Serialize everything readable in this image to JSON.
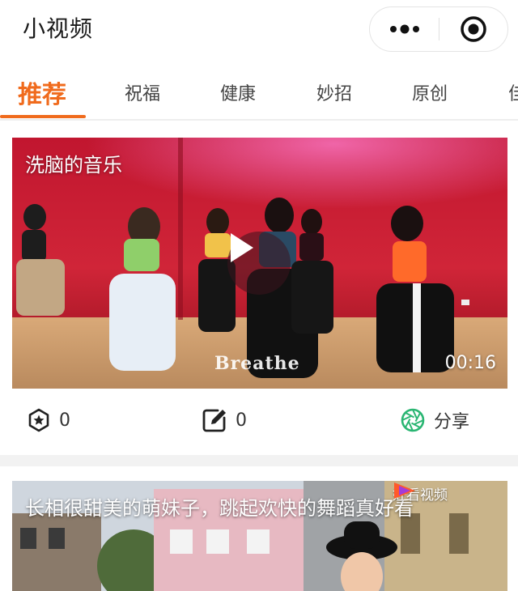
{
  "header": {
    "title": "小视频",
    "more_icon": "more-dots-icon",
    "close_icon": "target-icon"
  },
  "tabs": [
    {
      "label": "推荐",
      "active": true
    },
    {
      "label": "祝福",
      "active": false
    },
    {
      "label": "健康",
      "active": false
    },
    {
      "label": "妙招",
      "active": false
    },
    {
      "label": "原创",
      "active": false
    },
    {
      "label": "佳",
      "active": false
    }
  ],
  "colors": {
    "accent": "#f06b1d",
    "share_green": "#2bb673",
    "background": "#ffffff",
    "separator": "#f2f2f2"
  },
  "video1": {
    "title": "洗脑的音乐",
    "overlay_text": "Breathe",
    "duration": "00:16",
    "play_icon": "play-icon",
    "actions": {
      "favorite_count": "0",
      "comment_count": "0",
      "share_label": "分享"
    }
  },
  "video2": {
    "title": "长相很甜美的萌妹子，跳起欢快的舞蹈真好看",
    "brand": "好看视频"
  }
}
